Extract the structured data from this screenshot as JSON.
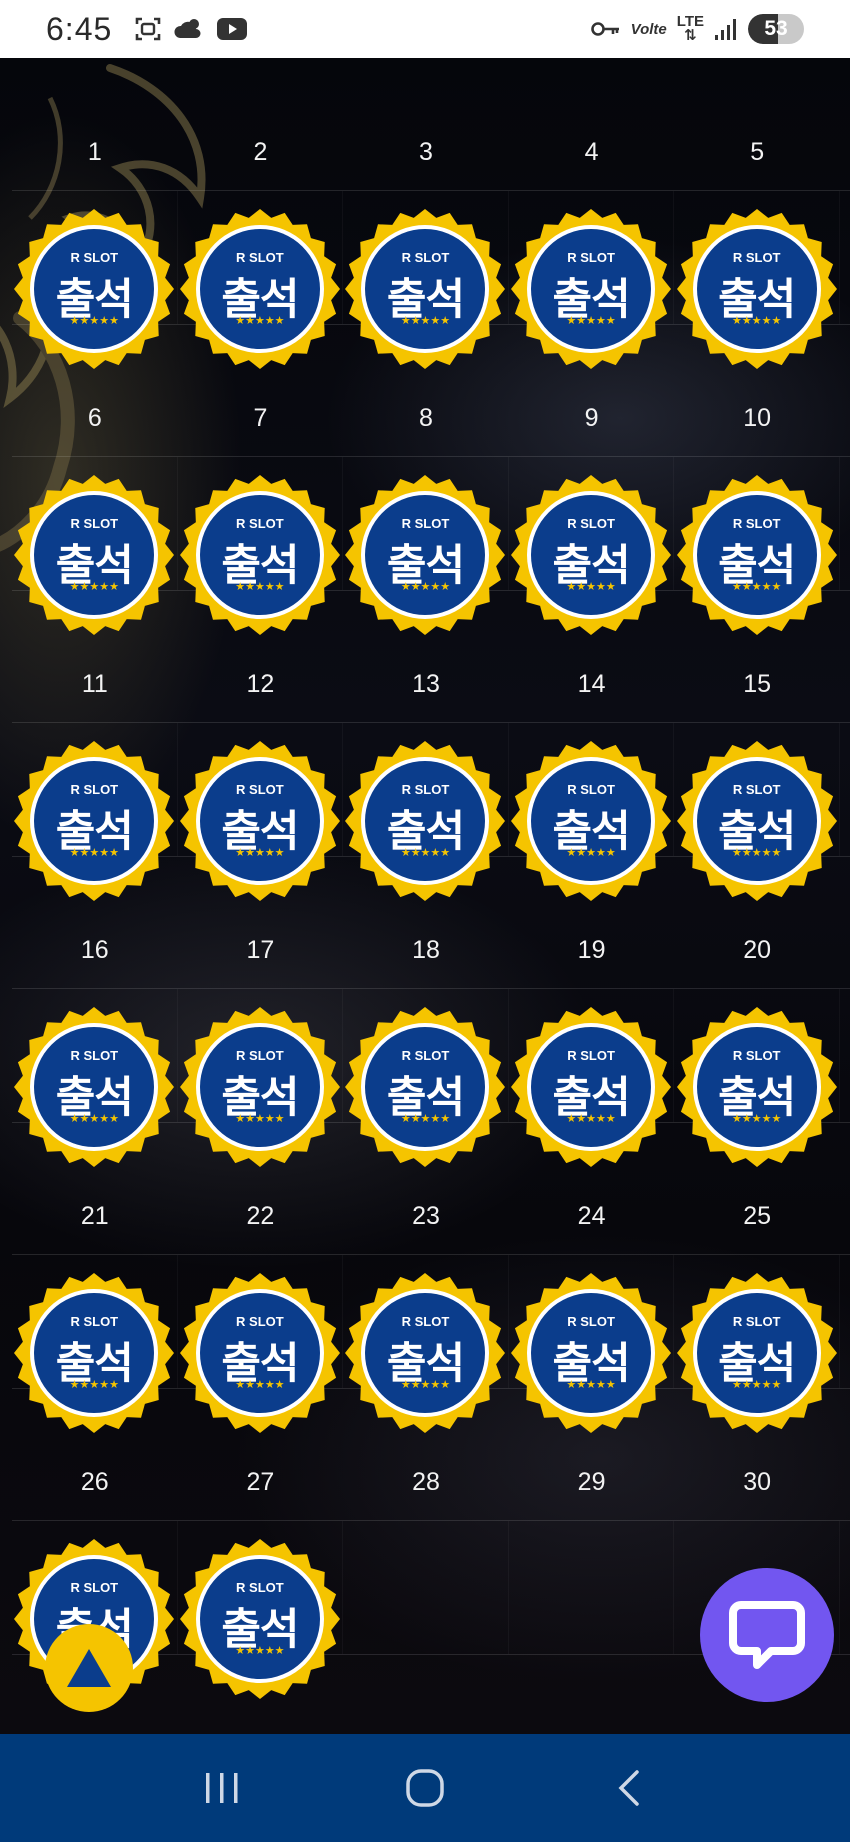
{
  "status_bar": {
    "time": "6:45",
    "left_icons": [
      "screenshot-icon",
      "weather-icon",
      "youtube-icon"
    ],
    "right_icons": [
      "vpn-key-icon",
      "volte-icon",
      "lte-icon",
      "signal-icon"
    ],
    "volte_label": "Volte",
    "lte_label": "LTE",
    "battery_level": "53",
    "battery_fraction": 0.53
  },
  "calendar": {
    "weeks": [
      {
        "days": [
          "1",
          "2",
          "3",
          "4",
          "5"
        ],
        "stamped": [
          true,
          true,
          true,
          true,
          true
        ]
      },
      {
        "days": [
          "6",
          "7",
          "8",
          "9",
          "10"
        ],
        "stamped": [
          true,
          true,
          true,
          true,
          true
        ]
      },
      {
        "days": [
          "11",
          "12",
          "13",
          "14",
          "15"
        ],
        "stamped": [
          true,
          true,
          true,
          true,
          true
        ]
      },
      {
        "days": [
          "16",
          "17",
          "18",
          "19",
          "20"
        ],
        "stamped": [
          true,
          true,
          true,
          true,
          true
        ]
      },
      {
        "days": [
          "21",
          "22",
          "23",
          "24",
          "25"
        ],
        "stamped": [
          true,
          true,
          true,
          true,
          true
        ]
      },
      {
        "days": [
          "26",
          "27",
          "28",
          "29",
          "30"
        ],
        "stamped": [
          true,
          true,
          false,
          false,
          false
        ]
      }
    ],
    "stamp": {
      "brand": "R SLOT",
      "title": "출석",
      "stars": "★★★★★",
      "badge_color": "#0b3d8c",
      "rim_color": "#f5c400"
    }
  },
  "floating": {
    "scroll_top_icon": "triangle-up-icon",
    "chat_icon": "chat-bubble-icon",
    "chat_color": "#7256f0"
  },
  "nav_bar": {
    "color": "#003a7a",
    "buttons": [
      "recents-icon",
      "home-icon",
      "back-icon"
    ]
  }
}
